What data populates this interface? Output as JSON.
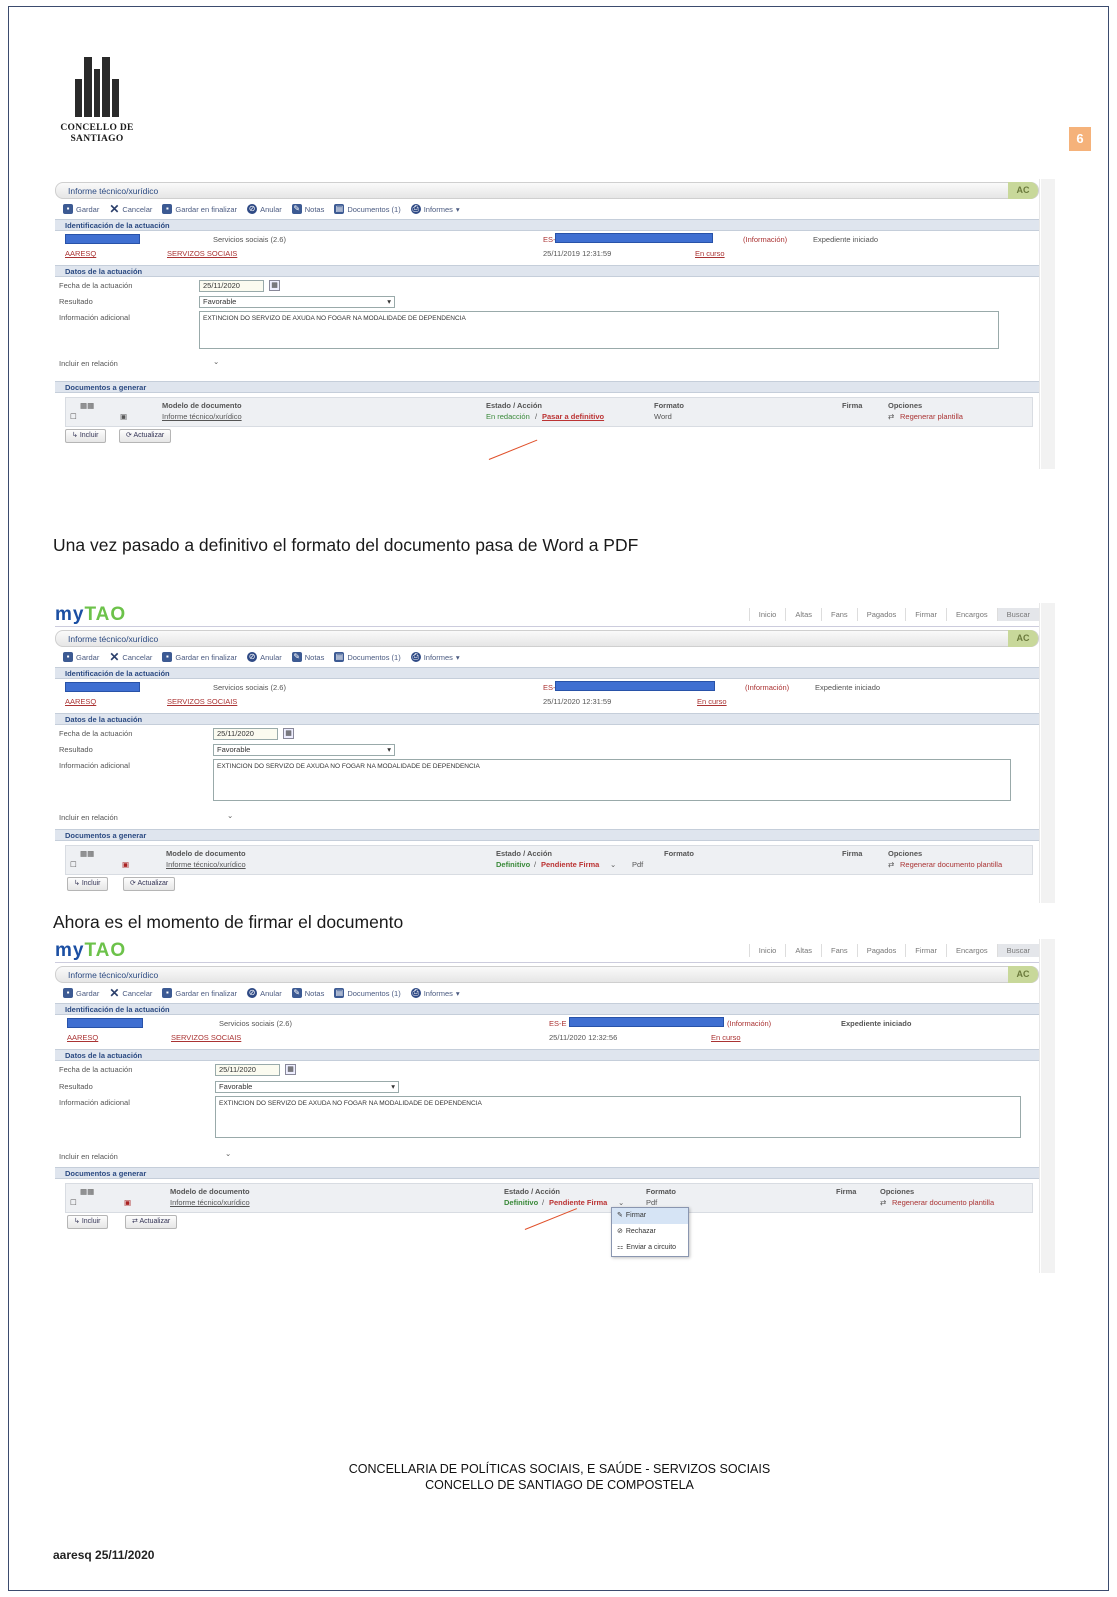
{
  "logo": {
    "line1": "CONCELLO DE",
    "line2": "SANTIAGO"
  },
  "page_number": "6",
  "captions": {
    "first": "Una vez pasado a definitivo el formato del documento pasa de Word a PDF",
    "second": "Ahora es el momento de firmar el documento"
  },
  "app": {
    "brand_my": "my",
    "brand_tao": "TAO",
    "nav": [
      "Inicio",
      "Altas",
      "Fans",
      "Pagados",
      "Firmar",
      "Encargos",
      "Buscar"
    ],
    "ac_badge": "AC",
    "window_title": "Informe técnico/xurídico",
    "toolbar": {
      "save": "Gardar",
      "cancel": "Cancelar",
      "save_close": "Gardar en finalizar",
      "cancel_action": "Anular",
      "notes": "Notas",
      "documents": "Documentos (1)",
      "reports": "Informes"
    },
    "section_ident": "Identificación de la actuación",
    "section_data": "Datos de la actuación",
    "section_docs": "Documentos a generar",
    "service": "Servicios sociais (2.6)",
    "code": "AARESQ",
    "dept": "SERVIZOS SOCIAIS",
    "info_link": "(Información)",
    "status": "Expediente iniciado",
    "in_progress": "En curso",
    "label_date": "Fecha de la actuación",
    "label_result": "Resultado",
    "label_info": "Información adicional",
    "label_related": "Incluir en relación",
    "result_value": "Favorable",
    "info_text": "EXTINCION DO SERVIZO DE AXUDA NO FOGAR NA MODALIDADE DE DEPENDENCIA",
    "col_model": "Modelo de documento",
    "col_state": "Estado / Acción",
    "col_format": "Formato",
    "col_sign": "Firma",
    "col_options": "Opciones",
    "doc_name": "Informe técnico/xurídico",
    "btn_new": "Incluir",
    "btn_update": "Actualizar"
  },
  "shots": [
    {
      "date": "25/11/2020",
      "timestamp": "25/11/2019 12:31:59",
      "state_prefix": "En redacción",
      "state_action": "Pasar a definitivo",
      "format": "Word",
      "option": "Regenerar plantilla",
      "id_prefix": "ES-"
    },
    {
      "date": "25/11/2020",
      "timestamp": "25/11/2020 12:31:59",
      "state_prefix": "Definitivo",
      "state_action": "Pendiente Firma",
      "format": "Pdf",
      "option": "Regenerar documento plantilla",
      "id_prefix": "ES-"
    },
    {
      "date": "25/11/2020",
      "timestamp": "25/11/2020 12:32:56",
      "state_prefix": "Definitivo",
      "state_action": "Pendiente Firma",
      "format": "Pdf",
      "option": "Regenerar documento plantilla",
      "id_prefix": "ES-E"
    }
  ],
  "menu": [
    "Firmar",
    "Rechazar",
    "Enviar a circuito"
  ],
  "footer": {
    "line1": "CONCELLARIA DE POLÍTICAS SOCIAIS, E SAÚDE - SERVIZOS SOCIAIS",
    "line2": "CONCELLO DE SANTIAGO DE COMPOSTELA"
  },
  "signature": "aaresq 25/11/2020",
  "colors": {
    "brand_blue": "#1b4fa3",
    "brand_green": "#6cc24a",
    "arrow": "#e0502a",
    "page_badge": "#f5b27a"
  }
}
